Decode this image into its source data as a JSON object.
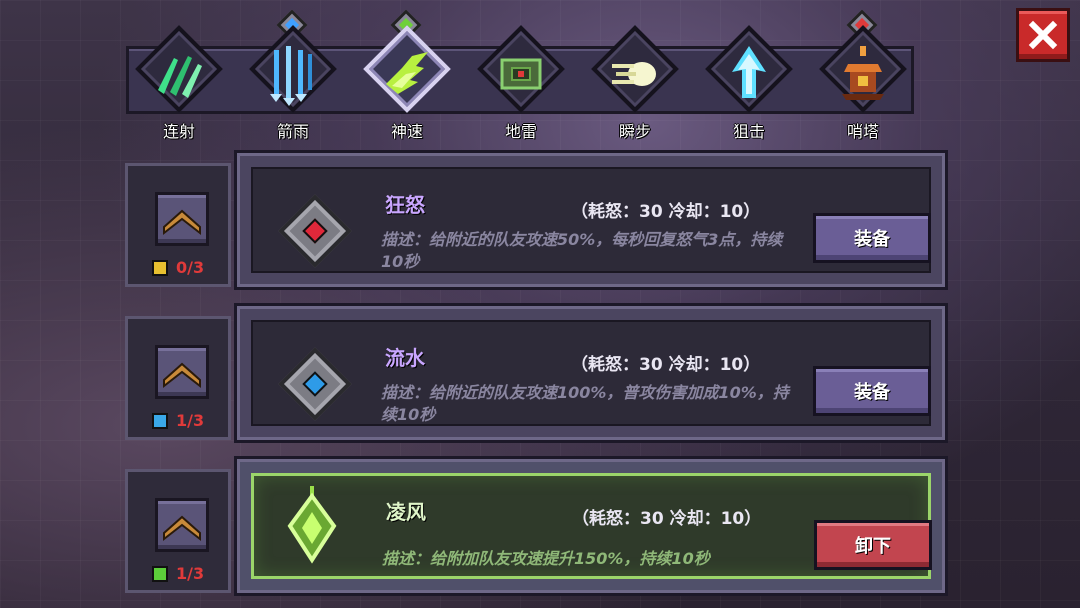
{
  "close_button": {
    "icon": "close-icon"
  },
  "tabs": [
    {
      "label": "连射",
      "icon": "multishot-icon",
      "color": "#3fe08a",
      "gem": null
    },
    {
      "label": "箭雨",
      "icon": "arrow-rain-icon",
      "color": "#4fb8ff",
      "gem": "#3fa0ff"
    },
    {
      "label": "神速",
      "icon": "swift-icon",
      "color": "#b8f040",
      "gem": "#6fd03a",
      "selected": true
    },
    {
      "label": "地雷",
      "icon": "landmine-icon",
      "color": "#8ad070",
      "gem": null
    },
    {
      "label": "瞬步",
      "icon": "blink-icon",
      "color": "#f0f0c0",
      "gem": null
    },
    {
      "label": "狙击",
      "icon": "snipe-icon",
      "color": "#5fe0ff",
      "gem": null
    },
    {
      "label": "哨塔",
      "icon": "tower-icon",
      "color": "#e07a30",
      "gem": "#e03a3a"
    }
  ],
  "skills": [
    {
      "name": "狂怒",
      "cost": "（耗怒：30  冷却：10）",
      "desc": "描述：给附近的队友攻速50%，每秒回复怒气3点，持续10秒",
      "level": "0/3",
      "gem_color": "#e0283a",
      "book_color": "#e8c030",
      "button": "装备",
      "active": false
    },
    {
      "name": "流水",
      "cost": "（耗怒：30  冷却：10）",
      "desc": "描述：给附近的队友攻速100%，普攻伤害加成10%，持续10秒",
      "level": "1/3",
      "gem_color": "#2e9be8",
      "book_color": "#3aa8e8",
      "button": "装备",
      "active": false
    },
    {
      "name": "凌风",
      "cost": "（耗怒：30  冷却：10）",
      "desc": "描述：给附加队友攻速提升150%，持续10秒",
      "level": "1/3",
      "gem_color": "#9be04a",
      "book_color": "#5ccf3a",
      "button": "卸下",
      "active": true
    }
  ]
}
